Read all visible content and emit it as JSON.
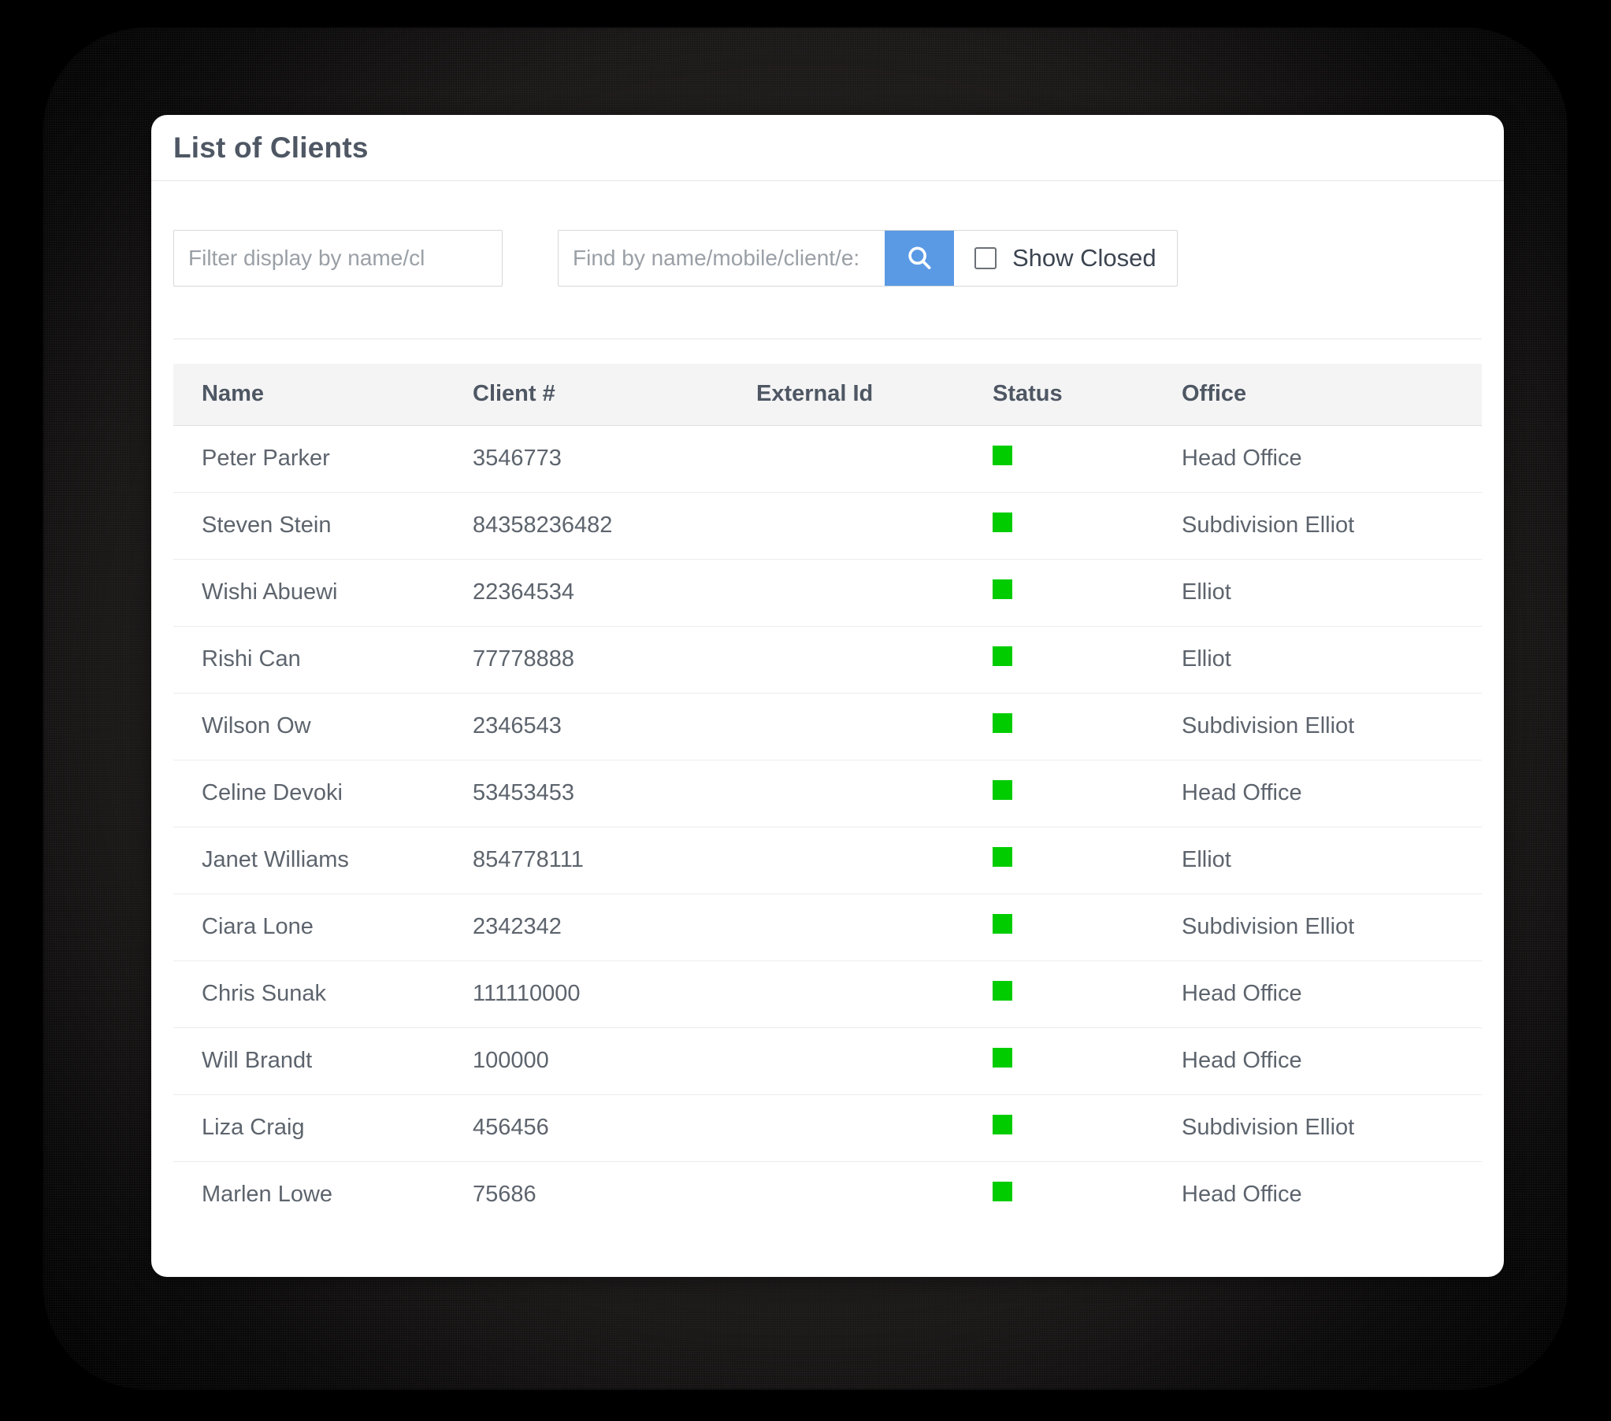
{
  "card": {
    "title": "List of Clients"
  },
  "controls": {
    "filter_placeholder": "Filter display by name/cl",
    "filter_value": "",
    "search_placeholder": "Find by name/mobile/client/e:",
    "search_value": "",
    "search_button_icon": "search-icon",
    "show_closed_label": "Show Closed",
    "show_closed_checked": false
  },
  "table": {
    "columns": [
      "Name",
      "Client #",
      "External Id",
      "Status",
      "Office"
    ],
    "rows": [
      {
        "name": "Peter Parker",
        "client": "3546773",
        "external": "",
        "status": "active",
        "office": "Head Office"
      },
      {
        "name": "Steven Stein",
        "client": "84358236482",
        "external": "",
        "status": "active",
        "office": "Subdivision Elliot"
      },
      {
        "name": "Wishi Abuewi",
        "client": "22364534",
        "external": "",
        "status": "active",
        "office": "Elliot"
      },
      {
        "name": "Rishi Can",
        "client": "77778888",
        "external": "",
        "status": "active",
        "office": "Elliot"
      },
      {
        "name": "Wilson Ow",
        "client": "2346543",
        "external": "",
        "status": "active",
        "office": "Subdivision Elliot"
      },
      {
        "name": "Celine Devoki",
        "client": "53453453",
        "external": "",
        "status": "active",
        "office": "Head Office"
      },
      {
        "name": "Janet Williams",
        "client": "854778111",
        "external": "",
        "status": "active",
        "office": "Elliot"
      },
      {
        "name": "Ciara Lone",
        "client": "2342342",
        "external": "",
        "status": "active",
        "office": "Subdivision Elliot"
      },
      {
        "name": "Chris Sunak",
        "client": "111110000",
        "external": "",
        "status": "active",
        "office": "Head Office"
      },
      {
        "name": "Will Brandt",
        "client": "100000",
        "external": "",
        "status": "active",
        "office": "Head Office"
      },
      {
        "name": "Liza Craig",
        "client": "456456",
        "external": "",
        "status": "active",
        "office": "Subdivision Elliot"
      },
      {
        "name": "Marlen Lowe",
        "client": "75686",
        "external": "",
        "status": "active",
        "office": "Head Office"
      }
    ]
  },
  "colors": {
    "accent_blue": "#5a9ae5",
    "status_green": "#00cc00",
    "title_gray": "#4e5763",
    "body_gray": "#5d646d",
    "header_bg": "#f4f4f4"
  }
}
